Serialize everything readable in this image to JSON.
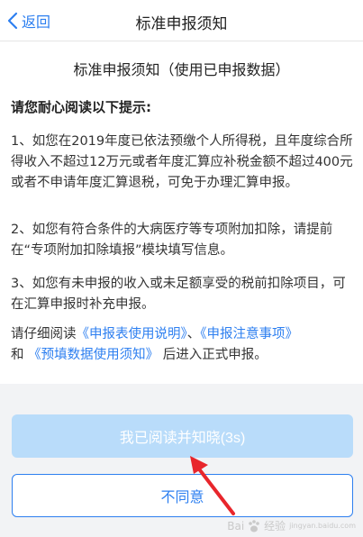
{
  "nav": {
    "back_label": "返回",
    "title": "标准申报须知"
  },
  "doc": {
    "title": "标准申报须知（使用已申报数据）",
    "notice_head": "请您耐心阅读以下提示:",
    "p1": "1、如您在2019年度已依法预缴个人所得税，且年度综合所得收入不超过12万元或者年度汇算应补税金额不超过400元或者不申请年度汇算退税，可免于办理汇算申报。",
    "p2": "2、如您有符合条件的大病医疗等专项附加扣除，请提前在“专项附加扣除填报”模块填写信息。",
    "p3": "3、如您有未申报的收入或未足额享受的税前扣除项目，可在汇算申报时补充申报。",
    "p4_prefix": "请仔细阅读",
    "link1": "《申报表使用说明》",
    "p4_sep": "、",
    "link2": "《申报注意事项》",
    "p4_and": "和",
    "link3": "《预填数据使用须知》",
    "p4_suffix": "后进入正式申报。"
  },
  "buttons": {
    "read_label": "我已阅读并知晓(3s)",
    "disagree_label": "不同意"
  },
  "watermark": {
    "text1": "Bai",
    "text2": "经验",
    "sub": "jingyan.baidu.com"
  },
  "colors": {
    "accent": "#2d7ff0",
    "disabled_button": "#b9dcfa",
    "arrow": "#e8262c"
  }
}
